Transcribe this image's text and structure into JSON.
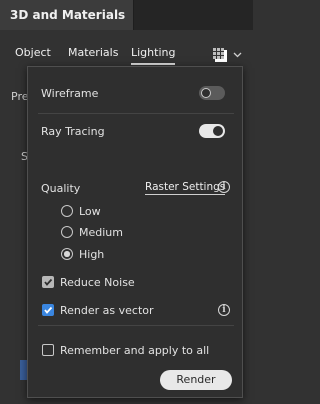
{
  "panel": {
    "title": "3D and Materials"
  },
  "tabs": [
    {
      "label": "Object"
    },
    {
      "label": "Materials"
    },
    {
      "label": "Lighting",
      "active": true
    }
  ],
  "toolbar": {
    "render_icon": "render-settings-icon",
    "chevron": "chevron-down-icon"
  },
  "behind": {
    "pre_text": "Pre",
    "s_text": "S"
  },
  "popup": {
    "wireframe": {
      "label": "Wireframe",
      "on": false
    },
    "ray_tracing": {
      "label": "Ray Tracing",
      "on": true
    },
    "quality": {
      "label": "Quality",
      "raster_link": "Raster Settings",
      "options": [
        {
          "label": "Low",
          "checked": false
        },
        {
          "label": "Medium",
          "checked": false
        },
        {
          "label": "High",
          "checked": true
        }
      ]
    },
    "reduce_noise": {
      "label": "Reduce Noise",
      "checked": true,
      "disabled": true
    },
    "render_as_vector": {
      "label": "Render as vector",
      "checked": true
    },
    "remember": {
      "label": "Remember and apply to all",
      "checked": false
    },
    "render_button": "Render",
    "colors": {
      "accent": "#3a86e0",
      "background": "#2f2f2f"
    }
  }
}
